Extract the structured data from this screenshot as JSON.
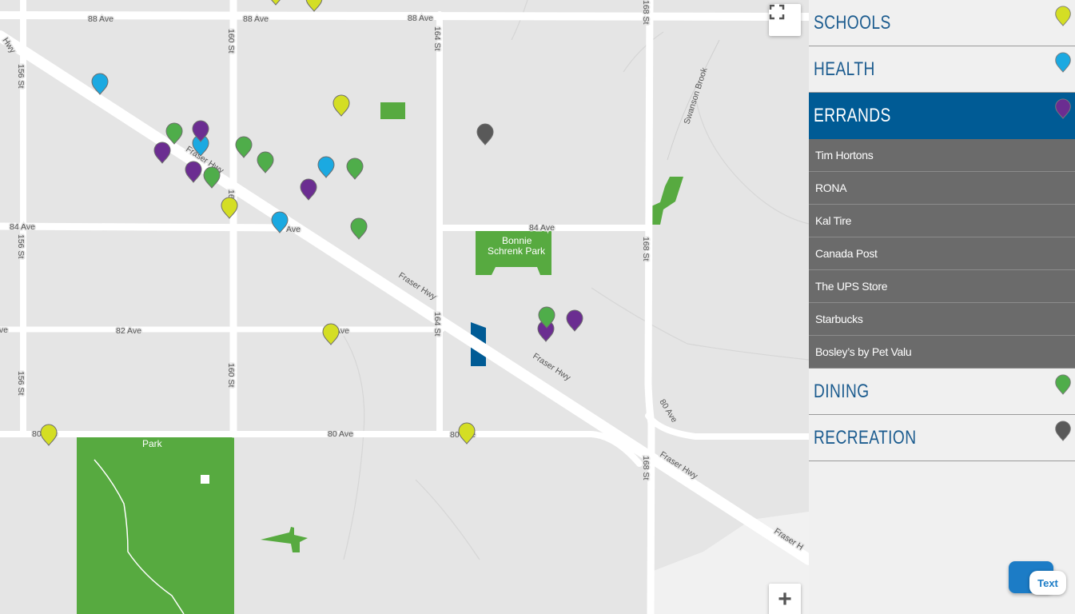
{
  "colors": {
    "schools": "#d4de24",
    "health": "#1ba9e1",
    "errands": "#6b2d91",
    "dining": "#4fad4a",
    "recreation": "#595959",
    "park": "#57aa40",
    "highlight": "#005b95",
    "road": "#ffffff",
    "land": "#e5e5e5"
  },
  "map": {
    "street_labels": {
      "ave88_a": "88 Ave",
      "ave88_b": "88 Ave",
      "ave88_c": "88 Ave",
      "ave84_a": "84 Ave",
      "ave84_b": "Ave",
      "ave84_c": "84 Ave",
      "ave82_a": "82 Ave",
      "ave82_b": "82 Ave",
      "ave82_c": "Ave",
      "ave80_a": "80 Ave",
      "ave80_b": "80 Ave",
      "ave80_c": "80 Ave",
      "ave80_d": "80 Ave",
      "st156_a": "156 St",
      "st156_b": "156 St",
      "st156_c": "156 St",
      "st160_a": "160 St",
      "st160_b": "160",
      "st160_c": "160 St",
      "st164_a": "164 St",
      "st164_b": "164 St",
      "st168_a": "168 St",
      "st168_b": "168 St",
      "st168_c": "168 St",
      "hwy_a": "Hwy",
      "hwy_b": "Fraser Hwy",
      "hwy_c": "Fraser Hwy",
      "hwy_d": "Fraser Hwy",
      "hwy_e": "Fraser Hwy",
      "hwy_f": "Fraser H",
      "creek": "Swanson Brook"
    },
    "park_labels": {
      "bonnie_line1": "Bonnie",
      "bonnie_line2": "Schrenk Park",
      "south_park": "Park"
    },
    "controls": {
      "fullscreen_icon": "fullscreen-icon",
      "zoom_in_label": "+"
    }
  },
  "sidebar": {
    "categories": [
      {
        "label": "SCHOOLS",
        "color": "#d4de24",
        "active": false
      },
      {
        "label": "HEALTH",
        "color": "#1ba9e1",
        "active": false
      },
      {
        "label": "ERRANDS",
        "color": "#6b2d91",
        "active": true,
        "items": [
          "Tim Hortons",
          "RONA",
          "Kal Tire",
          "Canada Post",
          "The UPS Store",
          "Starbucks",
          "Bosley’s by Pet Valu"
        ]
      },
      {
        "label": "DINING",
        "color": "#4fad4a",
        "active": false
      },
      {
        "label": "RECREATION",
        "color": "#595959",
        "active": false
      }
    ]
  },
  "chat": {
    "label": "Text"
  }
}
